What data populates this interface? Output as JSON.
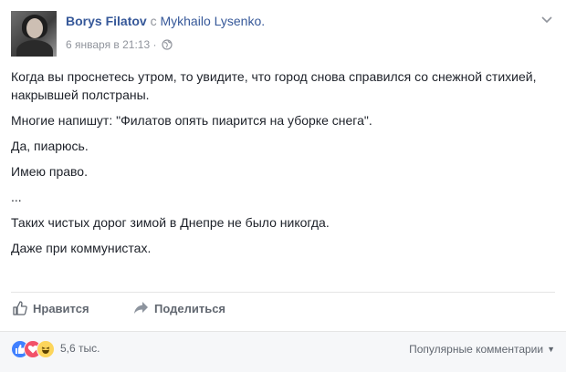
{
  "post": {
    "author": "Borys Filatov",
    "with_text": "с",
    "tagged": "Mykhailo Lysenko.",
    "timestamp": "6 января в 21:13",
    "separator": "·",
    "audience_icon": "globe-icon",
    "menu_icon": "chevron-down-icon",
    "paragraphs": [
      "Когда вы проснетесь утром, то увидите, что город снова справился со снежной стихией, накрывшей полстраны.",
      "Многие напишут: \"Филатов опять пиарится на уборке снега\".",
      "Да, пиарюсь.",
      "Имею право.",
      "...",
      "Таких чистых дорог зимой в Днепре не было никогда.",
      "Даже при коммунистах."
    ]
  },
  "actions": {
    "like_label": "Нравится",
    "share_label": "Поделиться"
  },
  "footer": {
    "reaction_count": "5,6 тыс.",
    "reactions": [
      "like",
      "love",
      "haha"
    ],
    "sort_label": "Популярные комментарии"
  },
  "colors": {
    "link": "#365899",
    "muted": "#90949c",
    "text": "#1d2129",
    "like": "#4080ff",
    "love": "#f25268",
    "haha": "#fcd55b"
  }
}
